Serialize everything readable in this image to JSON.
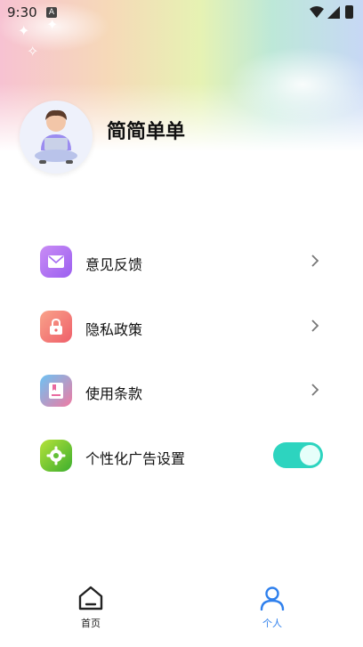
{
  "status": {
    "time": "9:30",
    "notification_badge": "A"
  },
  "profile": {
    "username": "简简单单"
  },
  "menu": [
    {
      "label": "意见反馈",
      "icon": "mail-icon",
      "color": "#b16cf2"
    },
    {
      "label": "隐私政策",
      "icon": "lock-icon",
      "color": "#f0736a"
    },
    {
      "label": "使用条款",
      "icon": "bookmark-icon",
      "color": "#5aaeea"
    }
  ],
  "ad_setting": {
    "label": "个性化广告设置",
    "icon": "gear-icon",
    "enabled": true,
    "color": "#2dd4bf"
  },
  "tabs": [
    {
      "label": "首页",
      "icon": "home-icon",
      "active": false
    },
    {
      "label": "个人",
      "icon": "user-icon",
      "active": true,
      "color": "#2f80ed"
    }
  ]
}
